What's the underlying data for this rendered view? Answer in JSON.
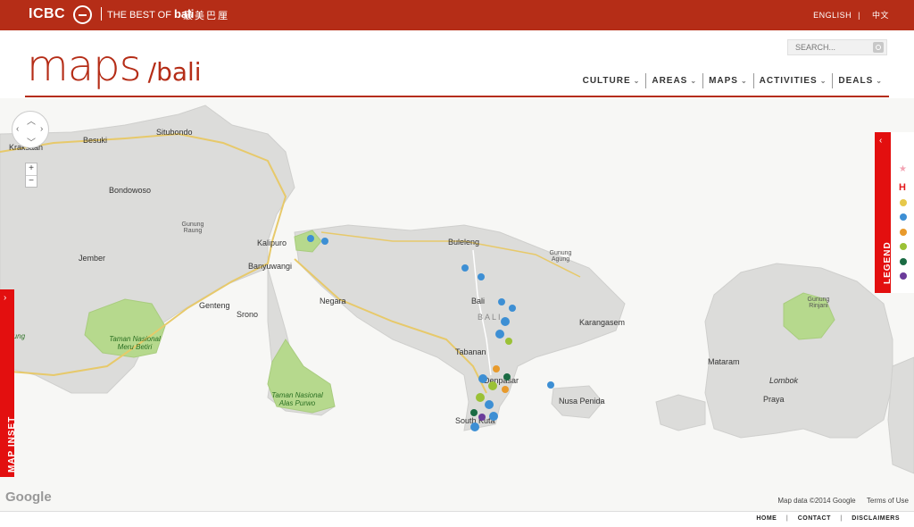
{
  "topbar": {
    "logo": "ICBC",
    "tagline": "THE BEST OF",
    "tagline_brand": "bali",
    "tagline_cn": "最美巴厘",
    "lang_en": "ENGLISH",
    "lang_sep": "|",
    "lang_cn": "中文"
  },
  "header": {
    "brand_main": "maps",
    "brand_sub": "/bali",
    "search_placeholder": "SEARCH...",
    "nav": [
      "CULTURE",
      "AREAS",
      "MAPS",
      "ACTIVITIES",
      "DEALS"
    ]
  },
  "map": {
    "places": {
      "krakstan": "Kraksaan",
      "besuki": "Besuki",
      "situbondo": "Situbondo",
      "bondowoso": "Bondowoso",
      "jember": "Jember",
      "banyuwangi": "Banyuwangi",
      "kalipuro": "Kalipuro",
      "genteng": "Genteng",
      "srono": "Srono",
      "buleleng": "Buleleng",
      "bali": "Bali",
      "negara": "Negara",
      "tabanan": "Tabanan",
      "denpasar": "Denpasar",
      "karangasem": "Karangasem",
      "nusa_penida": "Nusa Penida",
      "south_kuta": "South Kuta",
      "mataram": "Mataram",
      "lombok": "Lombok",
      "praya": "Praya",
      "bali_region": "BALI"
    },
    "parks": {
      "meru": "Taman Nasional Meru Betiri",
      "alas": "Taman Nasional Alas Purwo",
      "rung": "rung"
    },
    "mountains": {
      "raung": "Gunung Raung",
      "agung": "Gunung Agung",
      "rinjani": "Gunung Rinjani"
    },
    "legend_label": "LEGEND",
    "inset_label": "MAP INSET",
    "google": "Google",
    "map_data": "Map data ©2014 Google",
    "terms": "Terms of Use"
  },
  "legend_colors": [
    "#f3a3b3",
    "#e3191b",
    "#e6c84a",
    "#3d8fd4",
    "#e89a2c",
    "#9bc136",
    "#1a6b43",
    "#6b3b9a"
  ],
  "footer": {
    "home": "HOME",
    "contact": "CONTACT",
    "disclaimers": "DISCLAIMERS",
    "sep": "|"
  }
}
